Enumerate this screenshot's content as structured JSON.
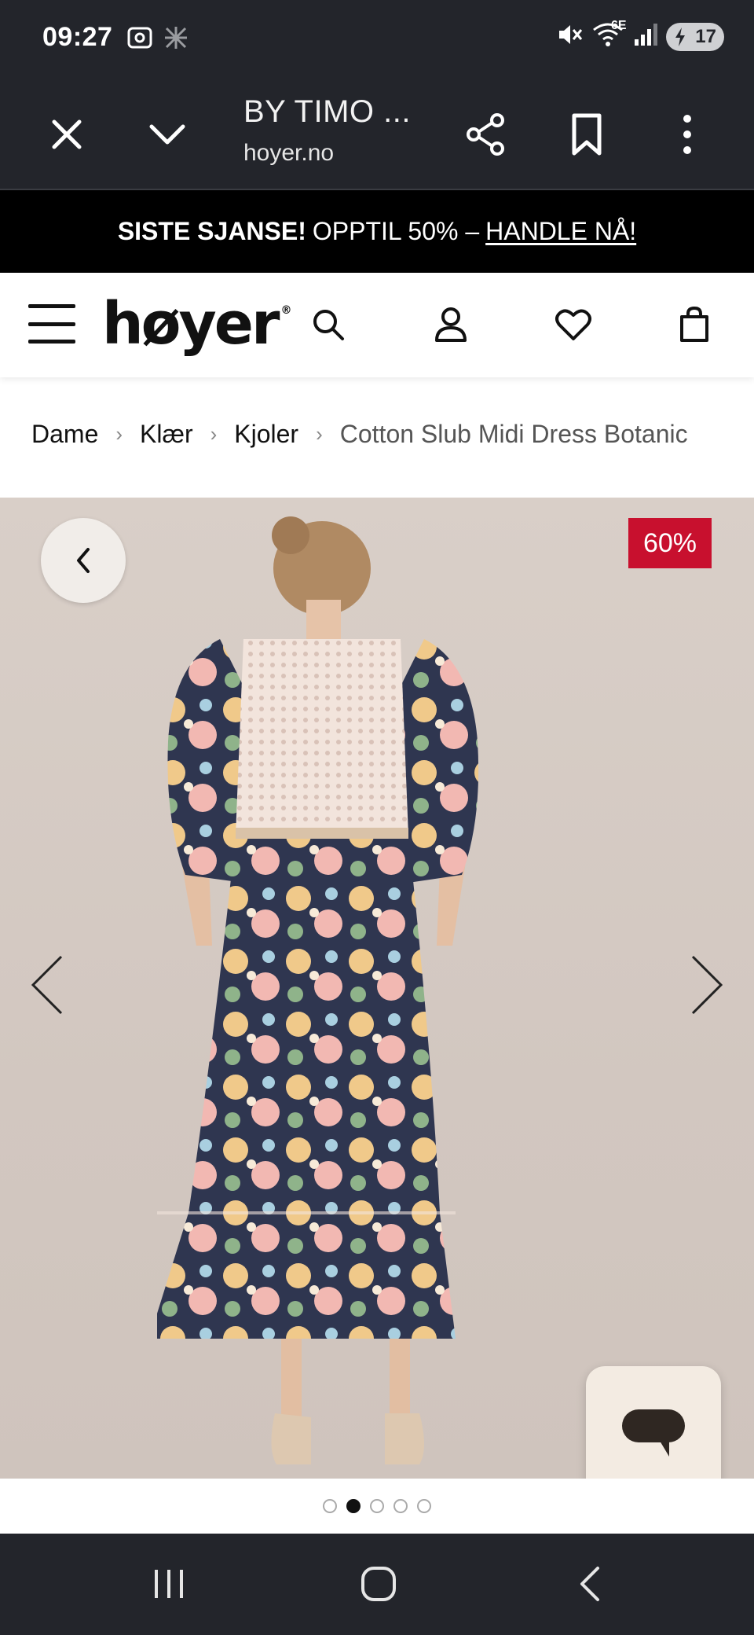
{
  "status_bar": {
    "time": "09:27",
    "network_label": "6E",
    "battery_level": "17",
    "icons": [
      "screenshot-icon",
      "gallery-icon",
      "mute-icon",
      "wifi-icon",
      "signal-icon",
      "battery-icon"
    ]
  },
  "browser": {
    "title": "BY TIMO ...",
    "domain": "hoyer.no",
    "icons": [
      "close-icon",
      "chevron-down-icon",
      "share-icon",
      "bookmark-icon",
      "more-vert-icon"
    ]
  },
  "promo": {
    "bold": "SISTE SJANSE!",
    "text": "OPPTIL 50% –",
    "cta": "HANDLE NÅ!"
  },
  "header": {
    "logo": "høyer",
    "logo_mark": "®",
    "icons": [
      "menu-icon",
      "search-icon",
      "account-icon",
      "wishlist-heart-icon",
      "cart-bag-icon"
    ]
  },
  "breadcrumb": {
    "items": [
      "Dame",
      "Klær",
      "Kjoler"
    ],
    "separator": "›",
    "current": "Cotton Slub Midi Dress Botanic"
  },
  "product": {
    "discount_badge": "60%",
    "image_count": 5,
    "active_image_index": 2
  },
  "colors": {
    "system_bar": "#23252b",
    "promo_bg": "#000000",
    "discount_red": "#c8102e",
    "chat_bg": "#f3ebe2"
  }
}
